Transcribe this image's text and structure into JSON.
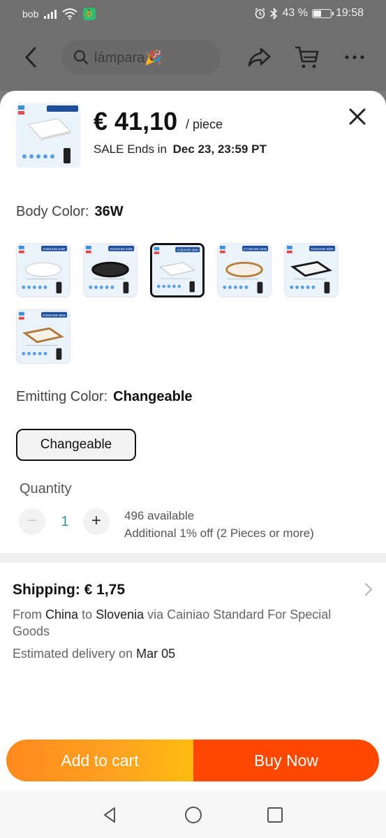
{
  "status_bar": {
    "carrier": "bob",
    "battery": "43 %",
    "battery_level": 0.43,
    "time": "19:58"
  },
  "header": {
    "search_text": "lámpara🎉"
  },
  "product": {
    "price": "€ 41,10",
    "price_unit": "/ piece",
    "sale_prefix": "SALE Ends in",
    "sale_end": "Dec 23, 23:59 PT"
  },
  "body_color": {
    "label": "Body Color:",
    "value": "36W",
    "options": [
      {
        "tag": "KZB2436-24W",
        "style": "white-round"
      },
      {
        "tag": "KZH2436-24W",
        "style": "black-round"
      },
      {
        "tag": "KZB2436-36W",
        "style": "white-square",
        "selected": true
      },
      {
        "tag": "KYM2436-24W",
        "style": "wood-round"
      },
      {
        "tag": "KZH2436-36W",
        "style": "black-square"
      },
      {
        "tag": "KZM2436-36W",
        "style": "wood-square"
      }
    ]
  },
  "emitting_color": {
    "label": "Emitting Color:",
    "value": "Changeable",
    "option": "Changeable"
  },
  "quantity": {
    "label": "Quantity",
    "value": "1",
    "minus": "−",
    "plus": "+",
    "available": "496 available",
    "discount": "Additional 1% off (2 Pieces or more)"
  },
  "shipping": {
    "title": "Shipping: € 1,75",
    "from_word": "From",
    "origin": "China",
    "to_word": "to",
    "destination": "Slovenia",
    "via_text": "via Cainiao Standard For Special Goods",
    "eta_prefix": "Estimated delivery on",
    "eta_date": "Mar 05"
  },
  "actions": {
    "add_to_cart": "Add to cart",
    "buy_now": "Buy Now"
  },
  "colors": {
    "accent_orange": "#ff8a1e",
    "accent_red": "#ff4800",
    "teal_qty": "#3a8fa6"
  }
}
